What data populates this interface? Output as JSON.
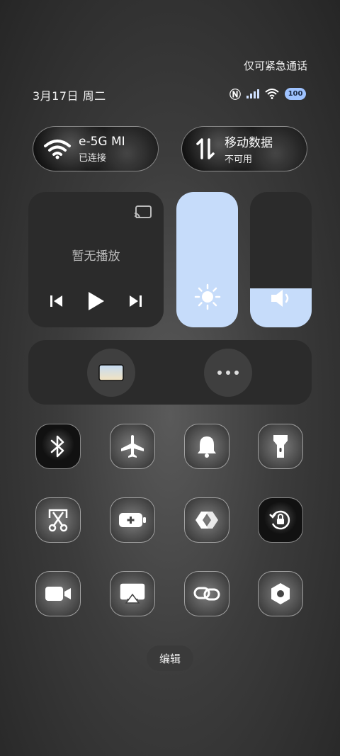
{
  "status": {
    "emergency": "仅可紧急通话",
    "date": "3月17日 周二",
    "battery": "100"
  },
  "wifi": {
    "title": "e-5G  MI",
    "subtitle": "已连接"
  },
  "mobile_data": {
    "title": "移动数据",
    "subtitle": "不可用"
  },
  "media": {
    "status": "暂无播放"
  },
  "sliders": {
    "brightness_level": 1.0,
    "volume_level": 0.29
  },
  "toggles": [
    {
      "name": "bluetooth-icon",
      "on": true
    },
    {
      "name": "airplane-icon",
      "on": false
    },
    {
      "name": "bell-icon",
      "on": false
    },
    {
      "name": "flashlight-icon",
      "on": false
    },
    {
      "name": "screenshot-scissors-icon",
      "on": false
    },
    {
      "name": "battery-saver-icon",
      "on": false
    },
    {
      "name": "nearby-share-icon",
      "on": false
    },
    {
      "name": "rotation-lock-icon",
      "on": true
    },
    {
      "name": "screen-record-icon",
      "on": false
    },
    {
      "name": "screen-cast-icon",
      "on": false
    },
    {
      "name": "link-icon",
      "on": false
    },
    {
      "name": "settings-hex-icon",
      "on": false
    }
  ],
  "edit": {
    "label": "编辑"
  },
  "colors": {
    "accent": "#c6dcfa",
    "panel": "#2b2b2b"
  }
}
